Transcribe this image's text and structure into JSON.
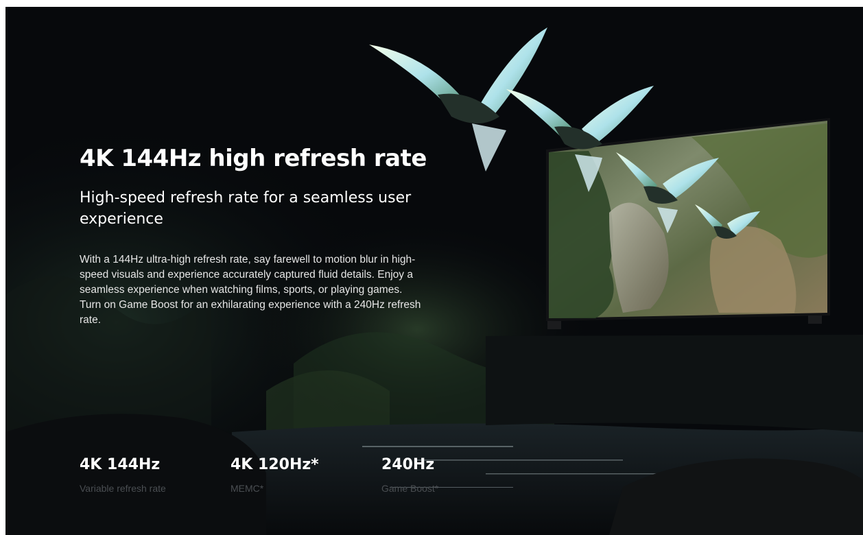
{
  "hero": {
    "headline": "4K 144Hz high refresh rate",
    "subheadline": "High-speed refresh rate for a seamless user experience",
    "body": "With a 144Hz ultra-high refresh rate, say farewell to motion blur in high-speed visuals and experience accurately captured fluid details. Enjoy a seamless experience when watching films, sports, or playing games. Turn on Game Boost for an exhilarating experience with a 240Hz refresh rate."
  },
  "stats": [
    {
      "value": "4K 144Hz",
      "label": "Variable refresh rate"
    },
    {
      "value": "4K 120Hz*",
      "label": "MEMC*"
    },
    {
      "value": "240Hz",
      "label": "Game Boost*"
    }
  ],
  "colors": {
    "background": "#07090c",
    "text_primary": "#ffffff",
    "text_muted": "#4a4e52",
    "foliage": "#2f4a2a",
    "bird_wing": "#cfe8ec"
  }
}
